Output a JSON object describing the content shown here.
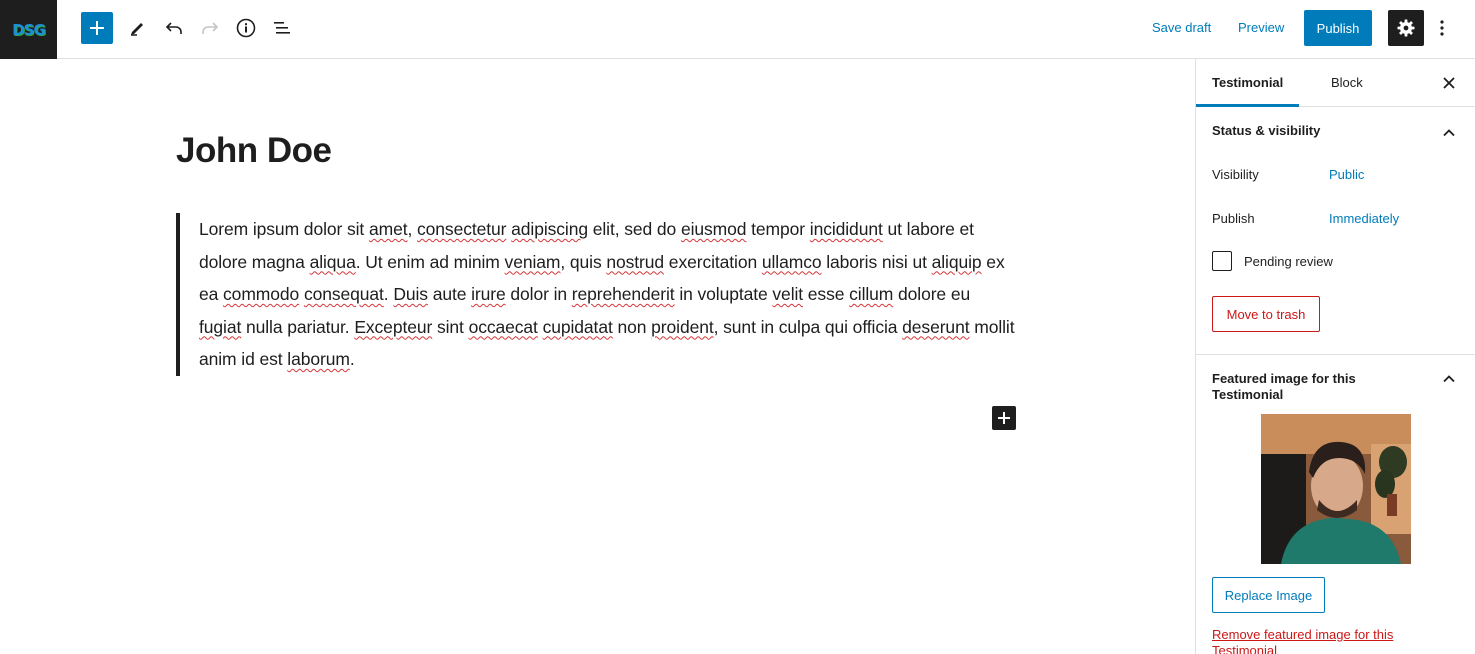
{
  "brand": {
    "logo_text": "DSG"
  },
  "toolbar": {
    "save_draft": "Save draft",
    "preview": "Preview",
    "publish": "Publish"
  },
  "editor": {
    "title": "John Doe",
    "quote_segments": [
      {
        "t": "Lorem ipsum dolor sit ",
        "s": false
      },
      {
        "t": "amet",
        "s": true
      },
      {
        "t": ", ",
        "s": false
      },
      {
        "t": "consectetur",
        "s": true
      },
      {
        "t": " ",
        "s": false
      },
      {
        "t": "adipiscing",
        "s": true
      },
      {
        "t": " elit, sed do ",
        "s": false
      },
      {
        "t": "eiusmod",
        "s": true
      },
      {
        "t": " tempor ",
        "s": false
      },
      {
        "t": "incididunt",
        "s": true
      },
      {
        "t": " ut labore et dolore magna ",
        "s": false
      },
      {
        "t": "aliqua",
        "s": true
      },
      {
        "t": ". Ut enim ad minim ",
        "s": false
      },
      {
        "t": "veniam",
        "s": true
      },
      {
        "t": ", quis ",
        "s": false
      },
      {
        "t": "nostrud",
        "s": true
      },
      {
        "t": " exercitation ",
        "s": false
      },
      {
        "t": "ullamco",
        "s": true
      },
      {
        "t": " laboris nisi ut ",
        "s": false
      },
      {
        "t": "aliquip",
        "s": true
      },
      {
        "t": " ex ea ",
        "s": false
      },
      {
        "t": "commodo",
        "s": true
      },
      {
        "t": " ",
        "s": false
      },
      {
        "t": "consequat",
        "s": true
      },
      {
        "t": ". ",
        "s": false
      },
      {
        "t": "Duis",
        "s": true
      },
      {
        "t": " aute ",
        "s": false
      },
      {
        "t": "irure",
        "s": true
      },
      {
        "t": " dolor in ",
        "s": false
      },
      {
        "t": "reprehenderit",
        "s": true
      },
      {
        "t": " in voluptate ",
        "s": false
      },
      {
        "t": "velit",
        "s": true
      },
      {
        "t": " esse ",
        "s": false
      },
      {
        "t": "cillum",
        "s": true
      },
      {
        "t": " dolore eu ",
        "s": false
      },
      {
        "t": "fugiat",
        "s": true
      },
      {
        "t": " nulla pariatur. ",
        "s": false
      },
      {
        "t": "Excepteur",
        "s": true
      },
      {
        "t": " sint ",
        "s": false
      },
      {
        "t": "occaecat",
        "s": true
      },
      {
        "t": " ",
        "s": false
      },
      {
        "t": "cupidatat",
        "s": true
      },
      {
        "t": " non ",
        "s": false
      },
      {
        "t": "proident",
        "s": true
      },
      {
        "t": ", sunt in culpa qui officia ",
        "s": false
      },
      {
        "t": "deserunt",
        "s": true
      },
      {
        "t": " mollit anim id est ",
        "s": false
      },
      {
        "t": "laborum",
        "s": true
      },
      {
        "t": ".",
        "s": false
      }
    ]
  },
  "sidebar": {
    "tabs": [
      {
        "label": "Testimonial",
        "active": true
      },
      {
        "label": "Block",
        "active": false
      }
    ],
    "status_panel": {
      "title": "Status & visibility",
      "visibility_label": "Visibility",
      "visibility_value": "Public",
      "publish_label": "Publish",
      "publish_value": "Immediately",
      "pending_review": "Pending review",
      "move_to_trash": "Move to trash"
    },
    "featured_panel": {
      "title": "Featured image for this Testimonial",
      "replace": "Replace Image",
      "remove": "Remove featured image for this Testimonial"
    }
  },
  "colors": {
    "accent": "#007cba",
    "danger": "#cc1818",
    "dark": "#1e1e1e",
    "spellcheck": "#d63638"
  }
}
